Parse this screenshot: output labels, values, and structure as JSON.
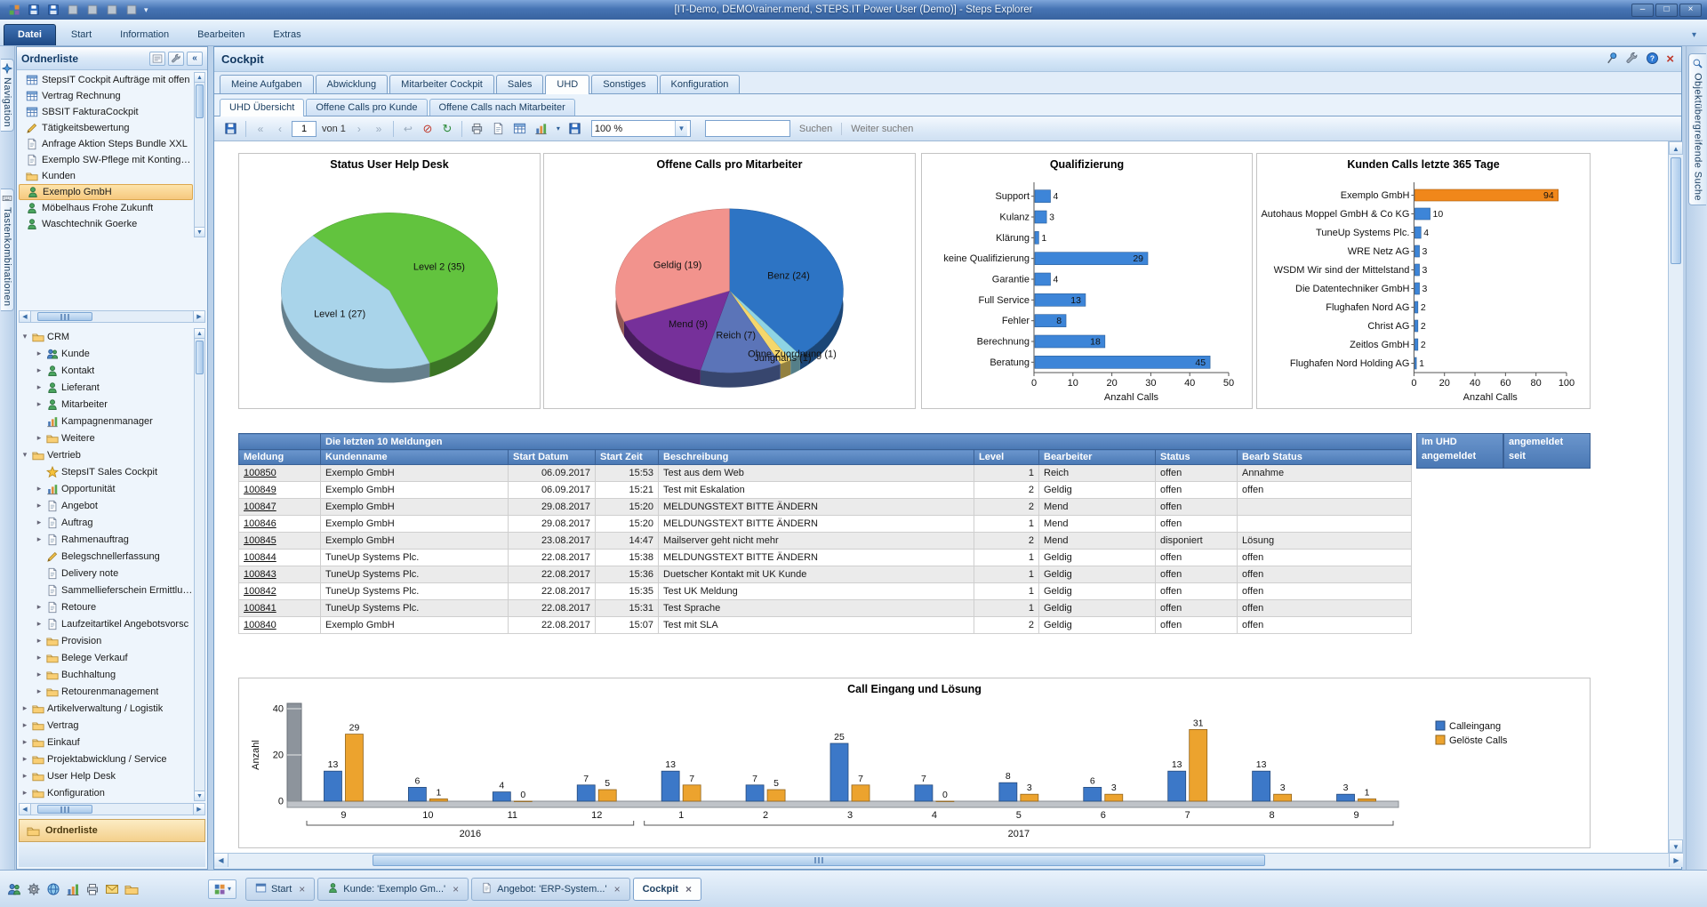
{
  "window": {
    "title": "[IT-Demo, DEMO\\rainer.mend, STEPS.IT Power User (Demo)] - Steps Explorer",
    "quick_access_icons": [
      "app-icon",
      "save-icon",
      "export-icon",
      "print-icon",
      "print-preview-icon",
      "page-setup-icon",
      "refresh-icon"
    ],
    "controls": {
      "minimize": "–",
      "maximize": "□",
      "close": "×"
    }
  },
  "menubar": {
    "items": [
      {
        "label": "Datei",
        "active": true
      },
      {
        "label": "Start"
      },
      {
        "label": "Information"
      },
      {
        "label": "Bearbeiten"
      },
      {
        "label": "Extras"
      }
    ]
  },
  "left_rail": {
    "tabs": [
      {
        "label": "Navigation",
        "icon": "compass-icon"
      },
      {
        "label": "Tastenkombinationen",
        "icon": "keyboard-icon"
      }
    ]
  },
  "right_rail": {
    "tabs": [
      {
        "label": "Objektübergreifende Suche",
        "icon": "magnifier-icon"
      }
    ]
  },
  "sidebar": {
    "title": "Ordnerliste",
    "header_icons": [
      "panel-menu-icon",
      "wrench-icon",
      "collapse-left-icon"
    ],
    "favorites": [
      {
        "label": "StepsIT Cockpit Aufträge mit offen",
        "icon": "grid"
      },
      {
        "label": "Vertrag Rechnung",
        "icon": "grid"
      },
      {
        "label": "SBSIT FakturaCockpit",
        "icon": "grid"
      },
      {
        "label": "Tätigkeitsbewertung",
        "icon": "pencil"
      },
      {
        "label": "Anfrage Aktion Steps Bundle XXL",
        "icon": "doc"
      },
      {
        "label": "Exemplo SW-Pflege mit Kontingent",
        "icon": "doc"
      },
      {
        "label": "Kunden",
        "icon": "folder"
      },
      {
        "label": "Exemplo GmbH",
        "icon": "person",
        "selected": true
      },
      {
        "label": "Möbelhaus Frohe Zukunft",
        "icon": "person"
      },
      {
        "label": "Waschtechnik Goerke",
        "icon": "person"
      }
    ],
    "tree": [
      {
        "label": "CRM",
        "icon": "folder",
        "level": 0,
        "arrow": "exp"
      },
      {
        "label": "Kunde",
        "icon": "people",
        "level": 1,
        "arrow": "col"
      },
      {
        "label": "Kontakt",
        "icon": "person",
        "level": 1,
        "arrow": "col"
      },
      {
        "label": "Lieferant",
        "icon": "person",
        "level": 1,
        "arrow": "col"
      },
      {
        "label": "Mitarbeiter",
        "icon": "person",
        "level": 1,
        "arrow": "col"
      },
      {
        "label": "Kampagnenmanager",
        "icon": "chart",
        "level": 1
      },
      {
        "label": "Weitere",
        "icon": "folder",
        "level": 1,
        "arrow": "col"
      },
      {
        "label": "Vertrieb",
        "icon": "folder",
        "level": 0,
        "arrow": "exp"
      },
      {
        "label": "StepsIT Sales Cockpit",
        "icon": "star",
        "level": 1
      },
      {
        "label": "Opportunität",
        "icon": "chart",
        "level": 1,
        "arrow": "col"
      },
      {
        "label": "Angebot",
        "icon": "doc",
        "level": 1,
        "arrow": "col"
      },
      {
        "label": "Auftrag",
        "icon": "doc",
        "level": 1,
        "arrow": "col"
      },
      {
        "label": "Rahmenauftrag",
        "icon": "doc",
        "level": 1,
        "arrow": "col"
      },
      {
        "label": "Belegschnellerfassung",
        "icon": "pencil",
        "level": 1
      },
      {
        "label": "Delivery note",
        "icon": "doc",
        "level": 1
      },
      {
        "label": "Sammellieferschein Ermittlung",
        "icon": "doc",
        "level": 1
      },
      {
        "label": "Retoure",
        "icon": "doc",
        "level": 1,
        "arrow": "col"
      },
      {
        "label": "Laufzeitartikel Angebotsvorsc",
        "icon": "doc",
        "level": 1,
        "arrow": "col"
      },
      {
        "label": "Provision",
        "icon": "folder",
        "level": 1,
        "arrow": "col"
      },
      {
        "label": "Belege Verkauf",
        "icon": "folder",
        "level": 1,
        "arrow": "col"
      },
      {
        "label": "Buchhaltung",
        "icon": "folder",
        "level": 1,
        "arrow": "col"
      },
      {
        "label": "Retourenmanagement",
        "icon": "folder",
        "level": 1,
        "arrow": "col"
      },
      {
        "label": "Artikelverwaltung / Logistik",
        "icon": "folder",
        "level": 0,
        "arrow": "col"
      },
      {
        "label": "Vertrag",
        "icon": "folder",
        "level": 0,
        "arrow": "col"
      },
      {
        "label": "Einkauf",
        "icon": "folder",
        "level": 0,
        "arrow": "col"
      },
      {
        "label": "Projektabwicklung / Service",
        "icon": "folder",
        "level": 0,
        "arrow": "col"
      },
      {
        "label": "User Help Desk",
        "icon": "folder",
        "level": 0,
        "arrow": "col"
      },
      {
        "label": "Konfiguration",
        "icon": "folder",
        "level": 0,
        "arrow": "col"
      }
    ],
    "bottom_button": "Ordnerliste",
    "footer_icons": [
      "users-icon",
      "gear-icon",
      "globe-icon",
      "chart-icon",
      "printer-icon",
      "mail-icon",
      "folder-icon"
    ]
  },
  "cockpit": {
    "title": "Cockpit",
    "header_icons": [
      "pin-icon",
      "wrench-icon",
      "help-icon",
      "close-icon"
    ],
    "tabs": [
      {
        "label": "Meine Aufgaben"
      },
      {
        "label": "Abwicklung"
      },
      {
        "label": "Mitarbeiter Cockpit"
      },
      {
        "label": "Sales"
      },
      {
        "label": "UHD",
        "active": true
      },
      {
        "label": "Sonstiges"
      },
      {
        "label": "Konfiguration"
      }
    ],
    "subtabs": [
      {
        "label": "UHD Übersicht",
        "active": true
      },
      {
        "label": "Offene Calls pro Kunde"
      },
      {
        "label": "Offene Calls nach Mitarbeiter"
      }
    ],
    "toolbar": {
      "page": "1",
      "of_label": "von 1",
      "zoom": "100 %",
      "search_value": "",
      "suchen": "Suchen",
      "weiter_suchen": "Weiter suchen"
    }
  },
  "table": {
    "group_header": "Die letzten 10 Meldungen",
    "columns": [
      "Meldung",
      "Kundenname",
      "Start Datum",
      "Start Zeit",
      "Beschreibung",
      "Level",
      "Bearbeiter",
      "Status",
      "Bearb Status"
    ],
    "rows": [
      [
        "100850",
        "Exemplo GmbH",
        "06.09.2017",
        "15:53",
        "Test aus dem Web",
        "1",
        "Reich",
        "offen",
        "Annahme"
      ],
      [
        "100849",
        "Exemplo GmbH",
        "06.09.2017",
        "15:21",
        "Test mit Eskalation",
        "2",
        "Geldig",
        "offen",
        "offen"
      ],
      [
        "100847",
        "Exemplo GmbH",
        "29.08.2017",
        "15:20",
        "MELDUNGSTEXT BITTE ÄNDERN",
        "2",
        "Mend",
        "offen",
        ""
      ],
      [
        "100846",
        "Exemplo GmbH",
        "29.08.2017",
        "15:20",
        "MELDUNGSTEXT BITTE ÄNDERN",
        "1",
        "Mend",
        "offen",
        ""
      ],
      [
        "100845",
        "Exemplo GmbH",
        "23.08.2017",
        "14:47",
        "Mailserver geht nicht mehr",
        "2",
        "Mend",
        "disponiert",
        "Lösung"
      ],
      [
        "100844",
        "TuneUp Systems Plc.",
        "22.08.2017",
        "15:38",
        "MELDUNGSTEXT BITTE ÄNDERN",
        "1",
        "Geldig",
        "offen",
        "offen"
      ],
      [
        "100843",
        "TuneUp Systems Plc.",
        "22.08.2017",
        "15:36",
        "Duetscher Kontakt mit UK Kunde",
        "1",
        "Geldig",
        "offen",
        "offen"
      ],
      [
        "100842",
        "TuneUp Systems Plc.",
        "22.08.2017",
        "15:35",
        "Test UK Meldung",
        "1",
        "Geldig",
        "offen",
        "offen"
      ],
      [
        "100841",
        "TuneUp Systems Plc.",
        "22.08.2017",
        "15:31",
        "Test Sprache",
        "1",
        "Geldig",
        "offen",
        "offen"
      ],
      [
        "100840",
        "Exemplo GmbH",
        "22.08.2017",
        "15:07",
        "Test mit SLA",
        "2",
        "Geldig",
        "offen",
        "offen"
      ]
    ],
    "side_columns": [
      "Im UHD\nangemeldet",
      "angemeldet\nseit"
    ]
  },
  "bottom_bar": {
    "close_glyph": "×",
    "tabs": [
      {
        "label": "Start",
        "icon": "window-icon"
      },
      {
        "label": "Kunde: 'Exemplo Gm...'",
        "icon": "person-icon"
      },
      {
        "label": "Angebot: 'ERP-System...'",
        "icon": "doc-icon"
      },
      {
        "label": "Cockpit",
        "active": true
      }
    ]
  },
  "chart_data": [
    {
      "id": "status-uhd",
      "type": "pie",
      "title": "Status User Help Desk",
      "start_angle": 225,
      "slices": [
        {
          "label": "Level 2 (35)",
          "value": 35,
          "color": "#62c33e"
        },
        {
          "label": "Level 1 (27)",
          "value": 27,
          "color": "#a9d4ea"
        }
      ]
    },
    {
      "id": "offene-calls",
      "type": "pie",
      "title": "Offene Calls pro Mitarbeiter",
      "start_angle": -90,
      "slices": [
        {
          "label": "Benz (24)",
          "value": 24,
          "color": "#2d74c4"
        },
        {
          "label": "Ohne Zuordnung (1)",
          "value": 1,
          "color": "#8ed4e4"
        },
        {
          "label": "Junghans (1)",
          "value": 1,
          "color": "#f5d76b"
        },
        {
          "label": "Reich (7)",
          "value": 7,
          "color": "#5b74b8"
        },
        {
          "label": "Mend (9)",
          "value": 9,
          "color": "#76309a"
        },
        {
          "label": "Geldig (19)",
          "value": 19,
          "color": "#f2938d"
        }
      ]
    },
    {
      "id": "qualifizierung",
      "type": "hbar",
      "title": "Qualifizierung",
      "categories": [
        "Support",
        "Kulanz",
        "Klärung",
        "keine Qualifizierung",
        "Garantie",
        "Full Service",
        "Fehler",
        "Berechnung",
        "Beratung"
      ],
      "values": [
        4,
        3,
        1,
        29,
        4,
        13,
        8,
        18,
        45
      ],
      "bar_color": "#3d85d8",
      "xlabel": "Anzahl Calls",
      "xticks": [
        0,
        10,
        20,
        30,
        40,
        50
      ],
      "xmax": 50
    },
    {
      "id": "kunden-calls",
      "type": "hbar",
      "title": "Kunden Calls letzte 365 Tage",
      "categories": [
        "Exemplo GmbH",
        "Autohaus Moppel GmbH & Co KG",
        "TuneUp Systems Plc.",
        "WRE Netz AG",
        "WSDM Wir sind der Mittelstand",
        "Die Datentechniker GmbH",
        "Flughafen Nord AG",
        "Christ AG",
        "Zeitlos GmbH",
        "Flughafen Nord Holding AG"
      ],
      "values": [
        94,
        10,
        4,
        3,
        3,
        3,
        2,
        2,
        2,
        1
      ],
      "bar_color": "#3d85d8",
      "highlight": {
        "index": 0,
        "color": "#f0871a"
      },
      "xlabel": "Anzahl Calls",
      "xticks": [
        0,
        20,
        40,
        60,
        80,
        100
      ],
      "xmax": 100
    },
    {
      "id": "call-eingang",
      "type": "grouped-bar",
      "title": "Call Eingang und Lösung",
      "ylabel": "Anzahl",
      "yticks": [
        0,
        20,
        40
      ],
      "ymax": 40,
      "categories": [
        "9",
        "10",
        "11",
        "12",
        "1",
        "2",
        "3",
        "4",
        "5",
        "6",
        "7",
        "8",
        "9"
      ],
      "group_spans": [
        {
          "label": "2016",
          "from": 0,
          "to": 3
        },
        {
          "label": "2017",
          "from": 4,
          "to": 12
        }
      ],
      "series": [
        {
          "name": "Calleingang",
          "color": "#3c78c8",
          "values": [
            13,
            6,
            4,
            7,
            13,
            7,
            25,
            7,
            8,
            6,
            13,
            13,
            3
          ]
        },
        {
          "name": "Gelöste Calls",
          "color": "#eca32e",
          "values": [
            29,
            1,
            0,
            5,
            7,
            5,
            7,
            0,
            3,
            3,
            31,
            3,
            1
          ]
        }
      ]
    }
  ]
}
